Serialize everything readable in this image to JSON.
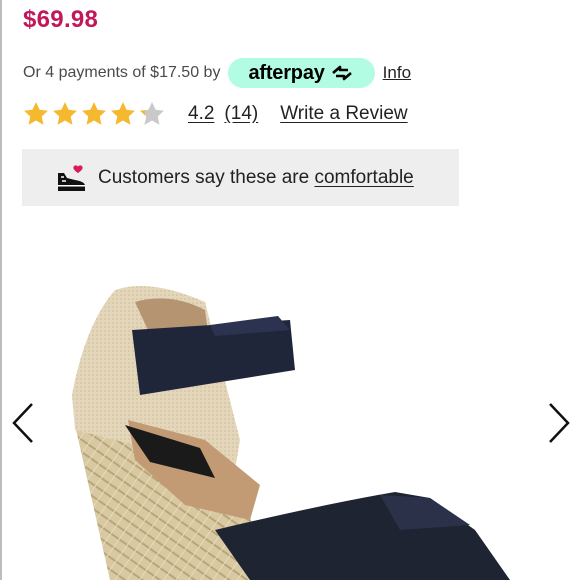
{
  "product": {
    "price": "$69.98"
  },
  "afterpay": {
    "text": "Or 4 payments of $17.50 by",
    "brand": "afterpay",
    "info_label": "Info",
    "badge_color": "#b2fce4"
  },
  "rating": {
    "value": "4.2",
    "count": "(14)",
    "stars_filled": 4.2,
    "stars_max": 5,
    "star_color": "#f5b82e",
    "write_review_label": "Write a Review"
  },
  "comfort": {
    "icon": "sneaker-heart-icon",
    "text": "Customers say these are",
    "link_label": "comfortable"
  },
  "gallery": {
    "prev_icon": "chevron-left-icon",
    "next_icon": "chevron-right-icon"
  },
  "colors": {
    "price": "#c2185b",
    "heart": "#d81b60",
    "navy": "#1f2433"
  }
}
